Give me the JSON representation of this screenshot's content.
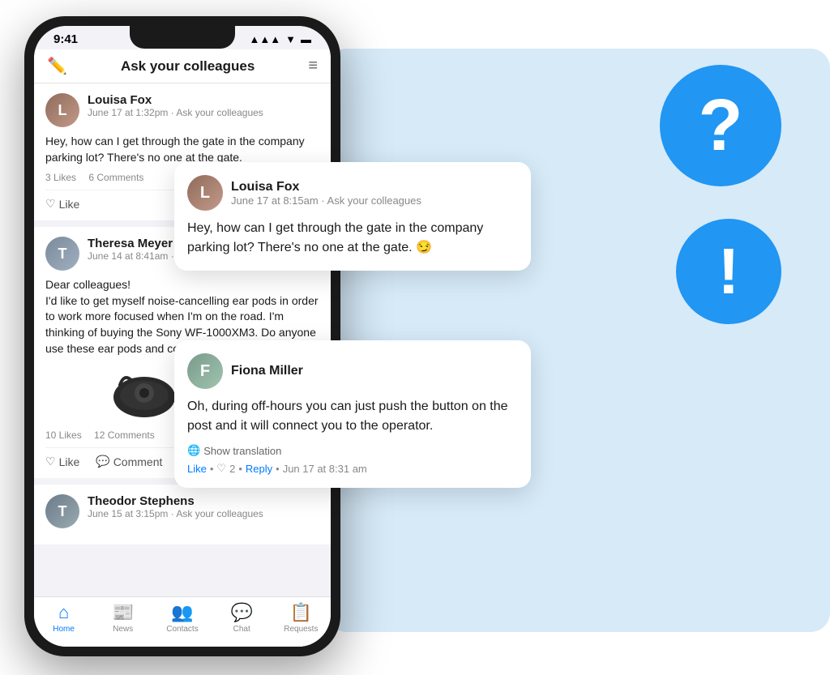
{
  "app": {
    "title": "Ask your colleagues"
  },
  "status_bar": {
    "time": "9:41",
    "icons": "▲ ▲▲ ◀ ▬"
  },
  "phone": {
    "posts": [
      {
        "author": "Louisa Fox",
        "date": "June 17 at 1:32pm · Ask your colleagues",
        "text": "Hey, how can I get through the gate in the company parking lot? There's no one at the gate.",
        "likes": "3 Likes",
        "comments": "6 Comments",
        "has_actions": true
      },
      {
        "author": "Theresa Meyer",
        "date": "June 14 at 8:41am ·",
        "text": "Dear colleagues!\nI'd like to get myself noise-cancelling ear pods in order to work more focused when I'm on the road. I'm thinking of buying the Sony WF-1000XM3. Does anyone use these ear pods and could help me with my decision?",
        "likes": "10 Likes",
        "comments": "12 Comments",
        "has_earphones": true,
        "has_actions": true
      },
      {
        "author": "Theodor Stephens",
        "date": "June 15 at 3:15pm · Ask your colleagues",
        "text": "",
        "has_actions": false
      }
    ],
    "tabs": [
      {
        "label": "Home",
        "icon": "⌂",
        "active": true
      },
      {
        "label": "News",
        "icon": "📰",
        "active": false
      },
      {
        "label": "Contacts",
        "icon": "👥",
        "active": false
      },
      {
        "label": "Chat",
        "icon": "💬",
        "active": false
      },
      {
        "label": "Requests",
        "icon": "📋",
        "active": false
      }
    ]
  },
  "floating_cards": {
    "question": {
      "author": "Louisa Fox",
      "date": "June 17 at 8:15am · Ask your colleagues",
      "text": "Hey, how can I get through the gate in the company parking lot? There's no one at the gate. 😏"
    },
    "answer": {
      "author": "Fiona Miller",
      "text": "Oh, during off-hours you can just push the button on the post and it will connect you to the operator.",
      "translation": "Show translation",
      "like_label": "Like",
      "like_count": "2",
      "reply_label": "Reply",
      "timestamp": "Jun 17 at 8:31 am"
    }
  },
  "circles": {
    "question_symbol": "?",
    "exclamation_symbol": "!"
  }
}
